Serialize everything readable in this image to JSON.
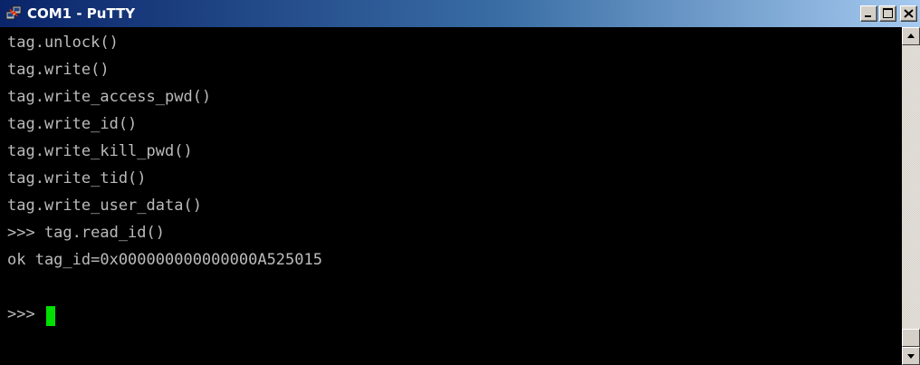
{
  "window": {
    "title": "COM1 - PuTTY",
    "icon": "putty-app-icon",
    "controls": {
      "minimize_icon": "minimize-icon",
      "maximize_icon": "maximize-icon",
      "close_icon": "close-icon"
    }
  },
  "terminal": {
    "colors": {
      "background": "#000000",
      "text": "#bbbbbb",
      "cursor": "#00e000"
    },
    "lines": [
      "tag.unlock()",
      "tag.write()",
      "tag.write_access_pwd()",
      "tag.write_id()",
      "tag.write_kill_pwd()",
      "tag.write_tid()",
      "tag.write_user_data()",
      ">>> tag.read_id()",
      "ok tag_id=0x000000000000000A525015",
      "",
      ">>> "
    ]
  },
  "scrollbar": {
    "up_icon": "scroll-up-arrow-icon",
    "down_icon": "scroll-down-arrow-icon"
  }
}
